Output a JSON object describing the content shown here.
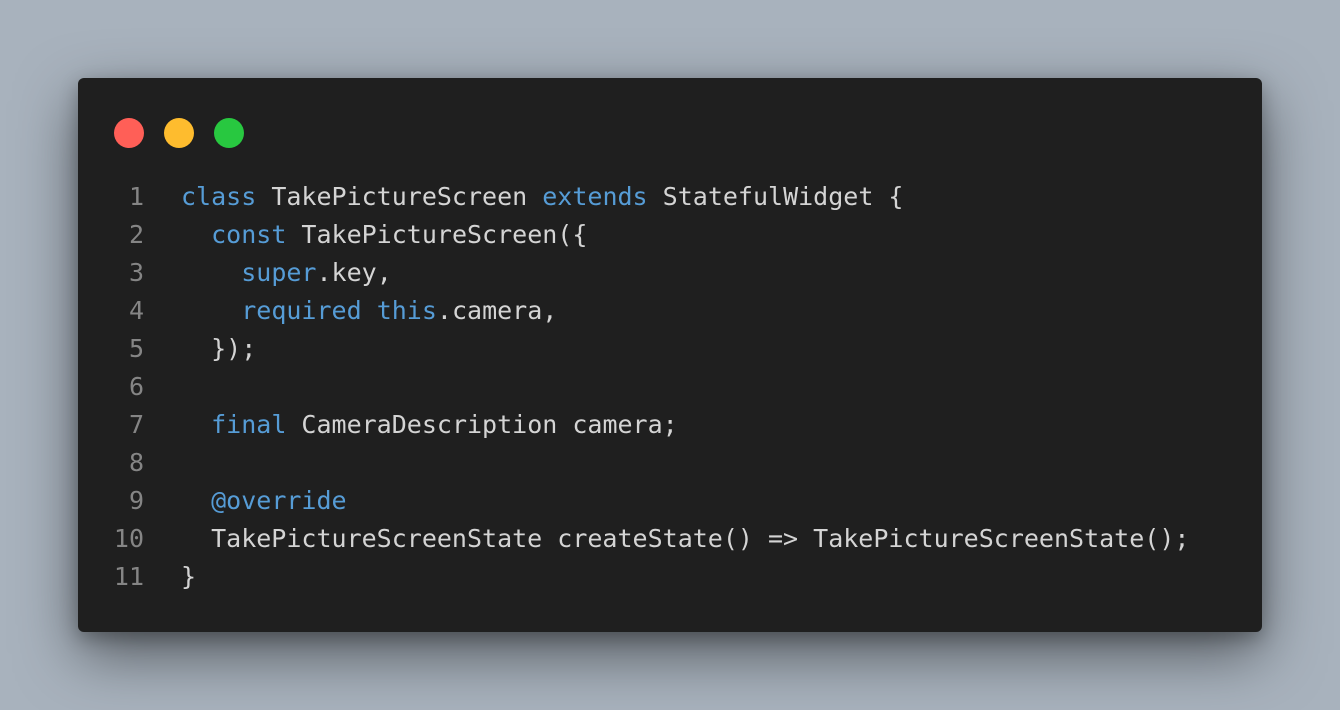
{
  "colors": {
    "background": "#a8b2bd",
    "window": "#1f1f1f",
    "close_dot": "#ff5f57",
    "minimize_dot": "#febc2e",
    "zoom_dot": "#28c840",
    "line_number": "#858585",
    "text": "#d4d4d4",
    "keyword": "#569cd6"
  },
  "code": {
    "lines": [
      {
        "number": "1",
        "tokens": [
          {
            "text": "class",
            "kind": "keyword"
          },
          {
            "text": " TakePictureScreen ",
            "kind": "plain"
          },
          {
            "text": "extends",
            "kind": "keyword"
          },
          {
            "text": " StatefulWidget {",
            "kind": "plain"
          }
        ]
      },
      {
        "number": "2",
        "tokens": [
          {
            "text": "  ",
            "kind": "plain"
          },
          {
            "text": "const",
            "kind": "keyword"
          },
          {
            "text": " TakePictureScreen({",
            "kind": "plain"
          }
        ]
      },
      {
        "number": "3",
        "tokens": [
          {
            "text": "    ",
            "kind": "plain"
          },
          {
            "text": "super",
            "kind": "keyword"
          },
          {
            "text": ".key,",
            "kind": "plain"
          }
        ]
      },
      {
        "number": "4",
        "tokens": [
          {
            "text": "    ",
            "kind": "plain"
          },
          {
            "text": "required",
            "kind": "keyword"
          },
          {
            "text": " ",
            "kind": "plain"
          },
          {
            "text": "this",
            "kind": "keyword"
          },
          {
            "text": ".camera,",
            "kind": "plain"
          }
        ]
      },
      {
        "number": "5",
        "tokens": [
          {
            "text": "  });",
            "kind": "plain"
          }
        ]
      },
      {
        "number": "6",
        "tokens": []
      },
      {
        "number": "7",
        "tokens": [
          {
            "text": "  ",
            "kind": "plain"
          },
          {
            "text": "final",
            "kind": "keyword"
          },
          {
            "text": " CameraDescription camera;",
            "kind": "plain"
          }
        ]
      },
      {
        "number": "8",
        "tokens": []
      },
      {
        "number": "9",
        "tokens": [
          {
            "text": "  ",
            "kind": "plain"
          },
          {
            "text": "@override",
            "kind": "keyword"
          }
        ]
      },
      {
        "number": "10",
        "tokens": [
          {
            "text": "  TakePictureScreenState createState() => TakePictureScreenState();",
            "kind": "plain"
          }
        ]
      },
      {
        "number": "11",
        "tokens": [
          {
            "text": "}",
            "kind": "plain"
          }
        ]
      }
    ]
  }
}
